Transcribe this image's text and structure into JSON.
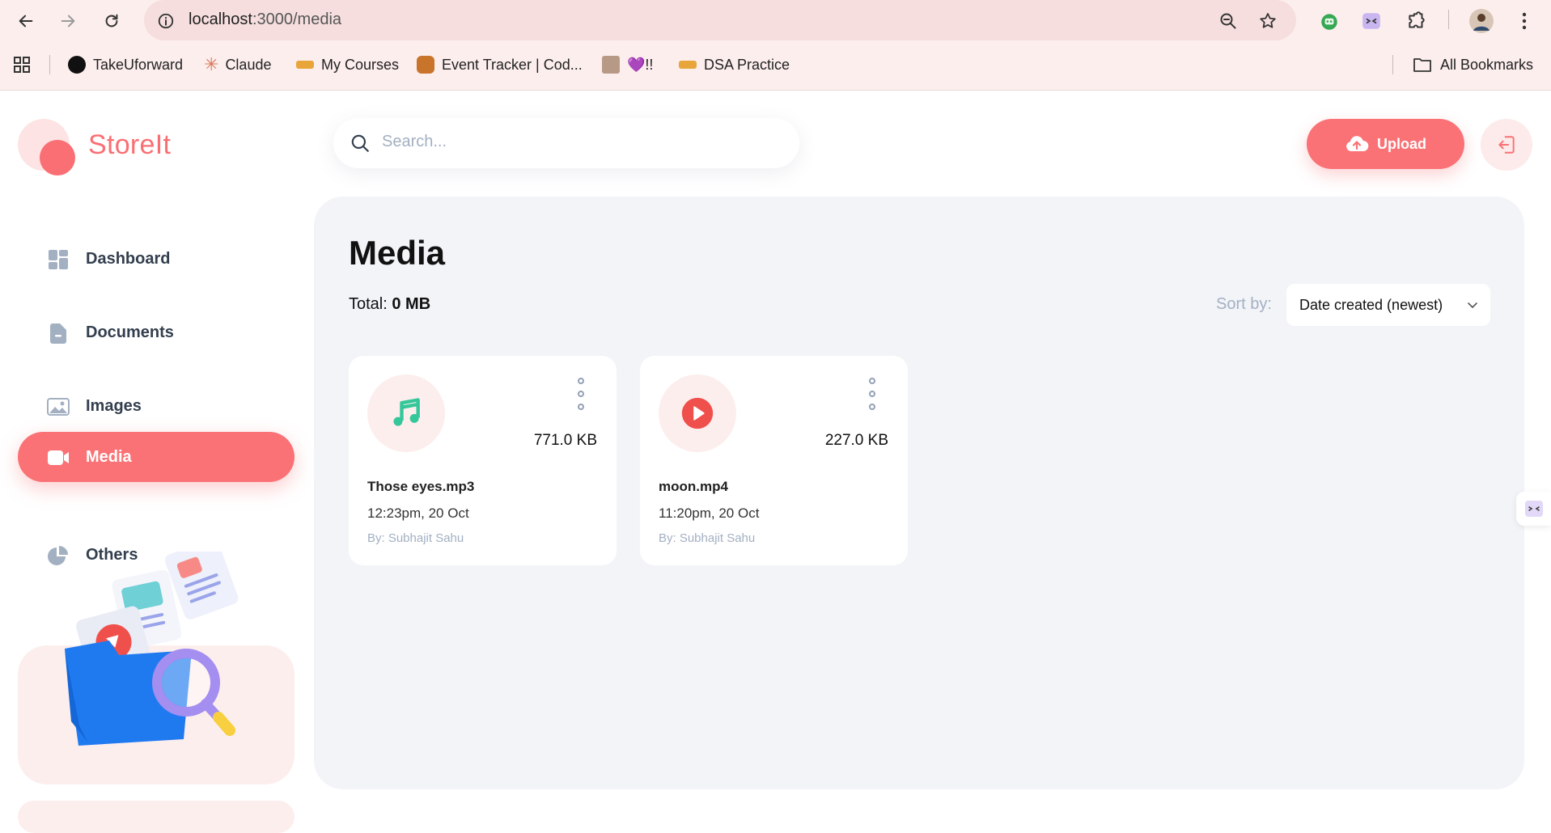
{
  "browser": {
    "url_host": "localhost",
    "url_path": ":3000/media",
    "bookmarks": [
      {
        "label": "TakeUforward",
        "color": "#111111"
      },
      {
        "label": "Claude",
        "color": "#d97757"
      },
      {
        "label": "My Courses",
        "color": "#e8a63a"
      },
      {
        "label": "Event Tracker | Cod...",
        "color": "#c8742a"
      },
      {
        "label": "💜!!",
        "color": "#b79a86"
      },
      {
        "label": "DSA Practice",
        "color": "#e8a63a"
      }
    ],
    "all_bookmarks": "All Bookmarks"
  },
  "app": {
    "logo_text": "StoreIt",
    "accent_color": "#fa7275",
    "nav": [
      {
        "label": "Dashboard",
        "icon": "dashboard-icon"
      },
      {
        "label": "Documents",
        "icon": "documents-icon"
      },
      {
        "label": "Images",
        "icon": "images-icon"
      },
      {
        "label": "Media",
        "icon": "media-icon",
        "active": true
      },
      {
        "label": "Others",
        "icon": "others-icon"
      }
    ],
    "search_placeholder": "Search...",
    "upload_label": "Upload"
  },
  "page": {
    "title": "Media",
    "total_label": "Total:",
    "total_value": "0 MB",
    "sort_label": "Sort by:",
    "sort_value": "Date created (newest)"
  },
  "files": [
    {
      "name": "Those eyes.mp3",
      "size": "771.0 KB",
      "date": "12:23pm, 20 Oct",
      "by": "By: Subhajit Sahu",
      "icon": "music-note-icon"
    },
    {
      "name": "moon.mp4",
      "size": "227.0 KB",
      "date": "11:20pm, 20 Oct",
      "by": "By: Subhajit Sahu",
      "icon": "play-icon"
    }
  ]
}
